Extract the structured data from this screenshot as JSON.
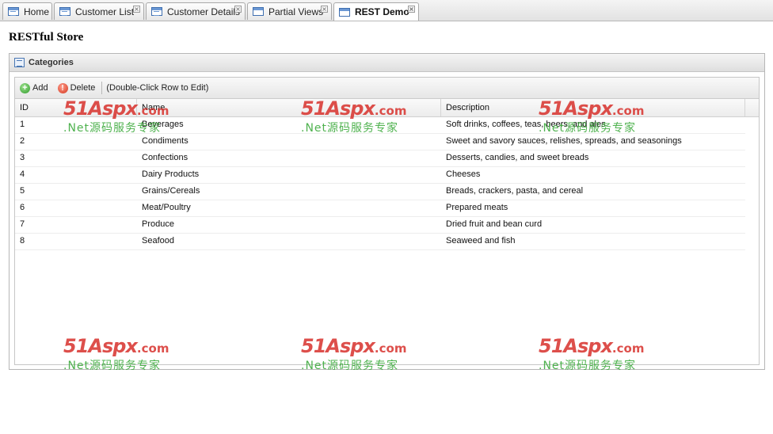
{
  "tabs": [
    {
      "label": "Home",
      "icon": "list-icon",
      "closable": false,
      "active": false
    },
    {
      "label": "Customer List",
      "icon": "list-icon",
      "closable": true,
      "active": false
    },
    {
      "label": "Customer Details",
      "icon": "list-icon",
      "closable": true,
      "active": false
    },
    {
      "label": "Partial Views",
      "icon": "window-icon",
      "closable": true,
      "active": false
    },
    {
      "label": "REST Demo",
      "icon": "window-icon",
      "closable": true,
      "active": true
    }
  ],
  "page": {
    "title": "RESTful Store"
  },
  "panel": {
    "title": "Categories"
  },
  "toolbar": {
    "add_label": "Add",
    "delete_label": "Delete",
    "hint": "(Double-Click Row to Edit)"
  },
  "grid": {
    "columns": [
      "ID",
      "Name",
      "Description"
    ],
    "rows": [
      {
        "id": "1",
        "name": "Beverages",
        "description": "Soft drinks, coffees, teas, beers, and ales"
      },
      {
        "id": "2",
        "name": "Condiments",
        "description": "Sweet and savory sauces, relishes, spreads, and seasonings"
      },
      {
        "id": "3",
        "name": "Confections",
        "description": "Desserts, candies, and sweet breads"
      },
      {
        "id": "4",
        "name": "Dairy Products",
        "description": "Cheeses"
      },
      {
        "id": "5",
        "name": "Grains/Cereals",
        "description": "Breads, crackers, pasta, and cereal"
      },
      {
        "id": "6",
        "name": "Meat/Poultry",
        "description": "Prepared meats"
      },
      {
        "id": "7",
        "name": "Produce",
        "description": "Dried fruit and bean curd"
      },
      {
        "id": "8",
        "name": "Seafood",
        "description": "Seaweed and fish"
      }
    ]
  },
  "watermark": {
    "brand": "51Aspx",
    "domain": ".com",
    "subtitle": ".Net源码服务专家"
  }
}
